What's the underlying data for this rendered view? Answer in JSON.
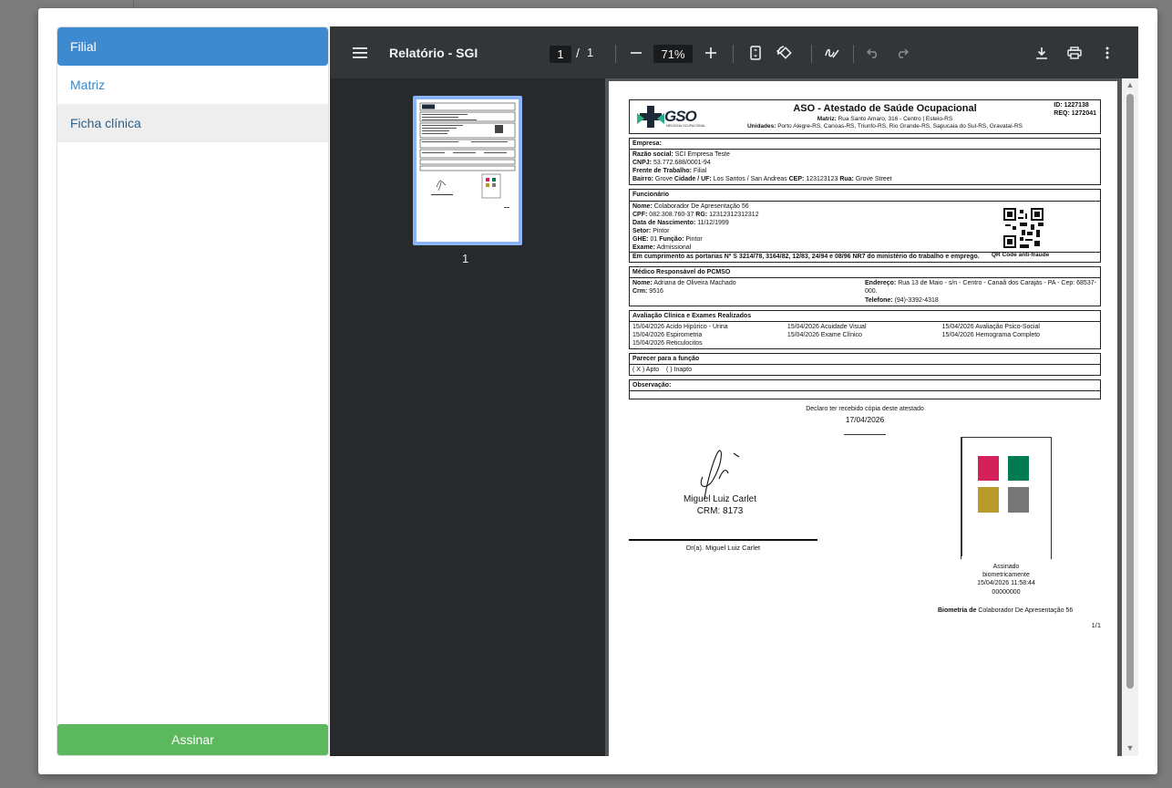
{
  "sidebar": {
    "items": [
      {
        "label": "Filial",
        "state": "active"
      },
      {
        "label": "Matriz",
        "state": "normal"
      },
      {
        "label": "Ficha clínica",
        "state": "hover"
      }
    ],
    "submit_label": "Assinar"
  },
  "viewer": {
    "title": "Relatório - SGI",
    "page_current": "1",
    "page_separator": "/",
    "page_total": "1",
    "zoom": "71%",
    "thumbnail_label": "1"
  },
  "doc": {
    "title": "ASO - Atestado de Saúde Ocupacional",
    "logo_text": "GSO",
    "logo_sub": "MEDICINA OCUPACIONAL",
    "matriz_label": "Matriz:",
    "matriz_value": "Rua Santo Amaro, 316 - Centro | Esteio-RS",
    "unidades_label": "Unidades:",
    "unidades_value": "Porto Alegre-RS, Canoas-RS, Triunfo-RS, Rio Grande-RS, Sapucaia do Sul-RS, Gravataí-RS",
    "id_line": "ID: 1227138",
    "req_line": "REQ: 1272041",
    "empresa": {
      "title": "Empresa:",
      "razao_label": "Razão social:",
      "razao": "SCI Empresa Teste",
      "cnpj_label": "CNPJ:",
      "cnpj": "53.772.688/0001-94",
      "frente_label": "Frente de Trabalho:",
      "frente": "Filial",
      "bairro_label": "Bairro:",
      "bairro": "Grove",
      "cidade_label": "Cidade / UF:",
      "cidade": "Los Santos / San Andreas",
      "cep_label": "CEP:",
      "cep": "123123123",
      "rua_label": "Rua:",
      "rua": "Grove Street"
    },
    "funcionario": {
      "title": "Funcionário",
      "nome_label": "Nome:",
      "nome": "Colaborador De Apresentação 56",
      "cpf_label": "CPF:",
      "cpf": "082.308.760-37",
      "rg_label": "RG:",
      "rg": "12312312312312",
      "nasc_label": "Data de Nascimento:",
      "nasc": "11/12/1999",
      "setor_label": "Setor:",
      "setor": "Pintor",
      "ghe_label": "GHE:",
      "ghe": "01",
      "funcao_label": "Função:",
      "funcao": "Pintor",
      "exame_label": "Exame:",
      "exame": "Admissional",
      "portarias": "Em cumprimento as portarias Nº S 3214/78, 3164/82, 12/83, 24/94 e 08/96 NR7 do ministério do trabalho e emprego.",
      "qr_label": "QR Code anti-fraude"
    },
    "medico": {
      "title": "Médico Responsável do PCMSO",
      "nome_label": "Nome:",
      "nome": "Adriana de Oliveira Machado",
      "crm_label": "Crm:",
      "crm": "9516",
      "endereco_label": "Endereço:",
      "endereco": "Rua 13 de Maio - s/n - Centro - Canaã dos Carajás - PA - Cep: 68537-000.",
      "telefone_label": "Telefone:",
      "telefone": "(94)-3392-4318"
    },
    "exames": {
      "title": "Avaliação Clínica e Exames Realizados",
      "items": [
        "15/04/2026 Acido Hipúrico - Urina",
        "15/04/2026 Acuidade Visual",
        "15/04/2026 Avaliação Psico-Social",
        "15/04/2026 Espirometria",
        "15/04/2026 Exame Clínico",
        "15/04/2026 Hemograma Completo",
        "15/04/2026 Reticulocitos"
      ]
    },
    "parecer": {
      "title": "Parecer para a função",
      "apto": "( X ) Apto",
      "inapto": "(   ) Inapto"
    },
    "observacao_title": "Observação:",
    "declaro": "Declaro ter recebido cópia deste atestado",
    "declaro_date": "17/04/2026",
    "sign_name": "Miguel Luiz Carlet",
    "sign_crm": "CRM: 8173",
    "doctor_caption": "Dr(a). Miguel Luiz Carlet",
    "bio_caption_1": "Assinado",
    "bio_caption_2": "biometricamente",
    "bio_datetime": "15/04/2026 11:58:44",
    "bio_code": "00000000",
    "biometria_label": "Biometria de",
    "biometria_name": "Colaborador De Apresentação 56",
    "page_footer": "1/1",
    "bio_colors": [
      "#d4215a",
      "#007a52",
      "#b89a2b",
      "#777777"
    ]
  }
}
